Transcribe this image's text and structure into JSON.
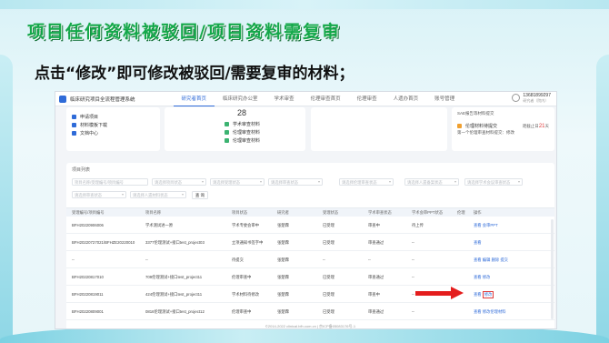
{
  "slide": {
    "title": "项目任何资料被驳回/项目资料需复审",
    "subtitle": "点击“修改”即可修改被驳回/需要复审的材料；"
  },
  "app": {
    "title": "临床研究项目全流程管理系统",
    "nav": [
      "研究者首页",
      "临床研究办公室",
      "学术审查",
      "伦理审查首页",
      "伦理审查",
      "人遗办首页",
      "账号管理"
    ],
    "user": {
      "phone": "13681899297",
      "sub": "研究者（院内）"
    },
    "cards": {
      "left_links": [
        "申请项目",
        "材料模板下载",
        "文档中心"
      ],
      "middle_count": "28",
      "middle_links": [
        "学术审查材料",
        "伦理审查材料",
        "伦理审查材料"
      ],
      "right_note1": "SAE报告等材料提交",
      "right_link": "伦理材料待提交",
      "right_note2": "第一个伦理审查材料提交：修改",
      "right_days_prefix": "距截止日",
      "right_days": "21",
      "right_days_suffix": "天"
    },
    "list_title": "项目列表",
    "filters": [
      "项目名称/受理编号/项目编号",
      "请选择项目状态",
      "请选择受理状态",
      "请选择审查状态",
      "请选择伦理审查状态",
      "请选择人遗备案状态",
      "请选择学术会议审查状态",
      "请选择审查状态",
      "请选择人遗材料状态"
    ],
    "query_label": "查 询",
    "columns": [
      "受理编号/项目编号",
      "项目名称",
      "项目状态",
      "研究者",
      "受理状态",
      "学术审查状态",
      "学术会审PPT状态",
      "伦理",
      "操作"
    ],
    "rows": [
      {
        "id": "BFH20220906006",
        "name": "学术测试进一原",
        "status": "学术专委会审中",
        "pi": "张楚霖",
        "accept": "已受理",
        "review": "审查中",
        "ppt": "待上传",
        "ops": [
          "查看",
          "会审PPT"
        ]
      },
      {
        "id": "BFH20220727021/BFHZE20220010",
        "name": "3377伦理测试+接口test_project03",
        "status": "立项通知书签字中",
        "pi": "张楚霖",
        "accept": "已受理",
        "review": "审查通过",
        "ppt": "--",
        "ops": [
          "查看"
        ]
      },
      {
        "id": "--",
        "name": "--",
        "status": "待提交",
        "pi": "张楚霖",
        "accept": "--",
        "review": "--",
        "ppt": "--",
        "ops": [
          "查看",
          "编辑",
          "删除",
          "提交"
        ]
      },
      {
        "id": "BFH20220817010",
        "name": "709伦理测试+接口test_project11",
        "status": "伦理审查中",
        "pi": "张楚霖",
        "accept": "已受理",
        "review": "审查通过",
        "ppt": "--",
        "ops": [
          "查看",
          "修改"
        ]
      },
      {
        "id": "BFH20220819011",
        "name": "424伦理测试+接口test_project11",
        "status": "学术材料待修改",
        "pi": "张楚霖",
        "accept": "已受理",
        "review": "审查中",
        "ppt": "--",
        "ops": [
          "查看",
          "修改"
        ]
      },
      {
        "id": "BFH20220809001",
        "name": "0816伦理测试+接口test_project12",
        "status": "伦理审查中",
        "pi": "张楚霖",
        "accept": "已受理",
        "review": "审查通过",
        "ppt": "--",
        "ops": [
          "查看",
          "修改伦理材料"
        ]
      }
    ],
    "footer": "©2014-2022 clinical.bfh.com.cn | 京ICP备05083176号-1"
  },
  "colors": {
    "title_green": "#14a84a",
    "accent_blue": "#2f6bd8",
    "arrow_red": "#e41d1d"
  }
}
